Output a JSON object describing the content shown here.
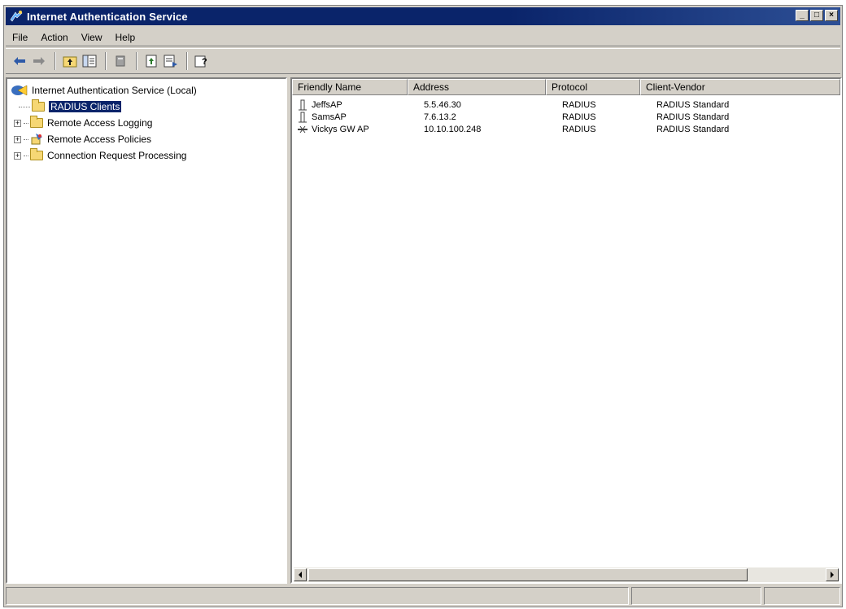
{
  "window": {
    "title": "Internet Authentication Service",
    "buttons": [
      "_",
      "□",
      "×"
    ]
  },
  "menu": [
    "File",
    "Action",
    "View",
    "Help"
  ],
  "toolbar": {
    "icons": [
      "back-arrow-icon",
      "forward-arrow-icon",
      "up-folder-icon",
      "show-hide-tree-icon",
      "delete-icon",
      "refresh-icon",
      "export-list-icon",
      "help-icon"
    ]
  },
  "tree": {
    "root": "Internet Authentication Service (Local)",
    "items": [
      {
        "label": "RADIUS Clients",
        "selected": true,
        "expander": ""
      },
      {
        "label": "Remote Access Logging",
        "selected": false,
        "expander": "+"
      },
      {
        "label": "Remote Access Policies",
        "selected": false,
        "expander": "+"
      },
      {
        "label": "Connection Request Processing",
        "selected": false,
        "expander": "+"
      }
    ]
  },
  "list": {
    "columns": [
      "Friendly Name",
      "Address",
      "Protocol",
      "Client-Vendor"
    ],
    "rows": [
      {
        "name": "JeffsAP",
        "address": "5.5.46.30",
        "protocol": "RADIUS",
        "vendor": "RADIUS Standard"
      },
      {
        "name": "SamsAP",
        "address": "7.6.13.2",
        "protocol": "RADIUS",
        "vendor": "RADIUS Standard"
      },
      {
        "name": "Vickys GW AP",
        "address": "10.10.100.248",
        "protocol": "RADIUS",
        "vendor": "RADIUS Standard"
      }
    ]
  },
  "colors": {
    "titlebar": "#0a246a",
    "selection": "#0a246a",
    "chrome": "#d4d0c8"
  }
}
